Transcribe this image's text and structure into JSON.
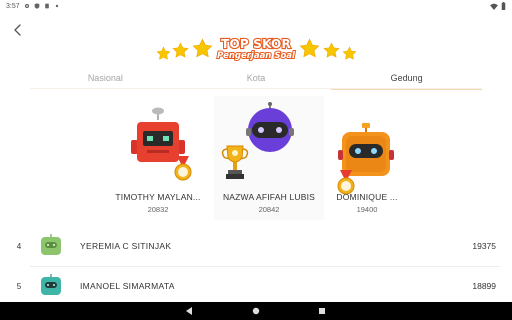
{
  "status_bar": {
    "time": "3:57",
    "left_icons": [
      "gear-icon",
      "shield-icon",
      "sim-icon",
      "dot-icon"
    ],
    "right_icons": [
      "wifi-icon",
      "battery-icon"
    ]
  },
  "header": {
    "title_line1": "TOP SKOR",
    "title_line2": "Pengerjaan Soal"
  },
  "tabs": [
    {
      "label": "Nasional",
      "active": false
    },
    {
      "label": "Kota",
      "active": false
    },
    {
      "label": "Gedung",
      "active": true
    }
  ],
  "podium": [
    {
      "rank": 2,
      "name": "TIMOTHY MAYLAN...",
      "score": "20832",
      "avatar": "red-robot-icon",
      "badge": "medal-icon"
    },
    {
      "rank": 1,
      "name": "NAZWA AFIFAH LUBIS",
      "score": "20842",
      "avatar": "purple-robot-icon",
      "badge": "trophy-icon"
    },
    {
      "rank": 3,
      "name": "DOMINIQUE ...",
      "score": "19400",
      "avatar": "orange-robot-icon",
      "badge": "medal-icon"
    }
  ],
  "list": [
    {
      "rank": "4",
      "name": "YEREMIA C SITINJAK",
      "score": "19375",
      "avatar": "green-robot-icon"
    },
    {
      "rank": "5",
      "name": "IMANOEL SIMARMATA",
      "score": "18899",
      "avatar": "teal-robot-icon"
    }
  ],
  "colors": {
    "title_stroke": "#e85b1f",
    "star": "#f7c600",
    "active_tab_underline": "#f7d8b5",
    "nav_bar": "#000000"
  }
}
